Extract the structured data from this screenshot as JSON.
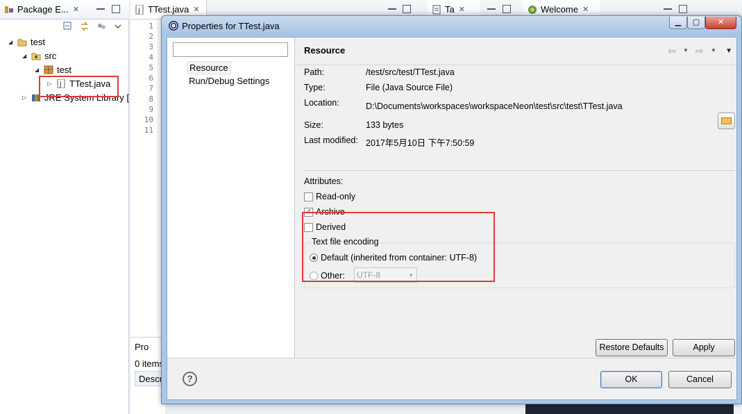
{
  "ide": {
    "package_tab": "Package E...",
    "editor_tab": "TTest.java",
    "tasks_tab": "Ta",
    "welcome_tab": "Welcome",
    "tree": {
      "project": "test",
      "src": "src",
      "package": "test",
      "file": "TTest.java",
      "jre": "JRE System Library ["
    },
    "line_numbers": [
      "1",
      "2",
      "3",
      "4",
      "5",
      "6",
      "7",
      "8",
      "9",
      "10",
      "11"
    ],
    "problems_tab": "Pro",
    "problems_count": "0 items",
    "problems_header": "Descr"
  },
  "dialog": {
    "title": "Properties for TTest.java",
    "filter_placeholder": "",
    "nav": [
      "Resource",
      "Run/Debug Settings"
    ],
    "page_title": "Resource",
    "props": {
      "path_label": "Path:",
      "path_value": "/test/src/test/TTest.java",
      "type_label": "Type:",
      "type_value": "File  (Java Source File)",
      "location_label": "Location:",
      "location_value": "D:\\Documents\\workspaces\\workspaceNeon\\test\\src\\test\\TTest.java",
      "size_label": "Size:",
      "size_value": "133  bytes",
      "modified_label": "Last modified:",
      "modified_value": "2017年5月10日 下午7:50:59"
    },
    "attributes": {
      "label": "Attributes:",
      "readonly": "Read-only",
      "archive": "Archive",
      "derived": "Derived",
      "readonly_checked": false,
      "archive_checked": true,
      "derived_checked": false
    },
    "encoding": {
      "title": "Text file encoding",
      "default_label": "Default (inherited from container: UTF-8)",
      "other_label": "Other:",
      "other_value": "UTF-8",
      "selected": "default"
    },
    "buttons": {
      "restore": "Restore Defaults",
      "apply": "Apply",
      "ok": "OK",
      "cancel": "Cancel"
    },
    "help_glyph": "?"
  },
  "colors": {
    "highlight": "#e0393e",
    "title_gradient_top": "#c9dcf0",
    "close_button": "#c7402f"
  }
}
